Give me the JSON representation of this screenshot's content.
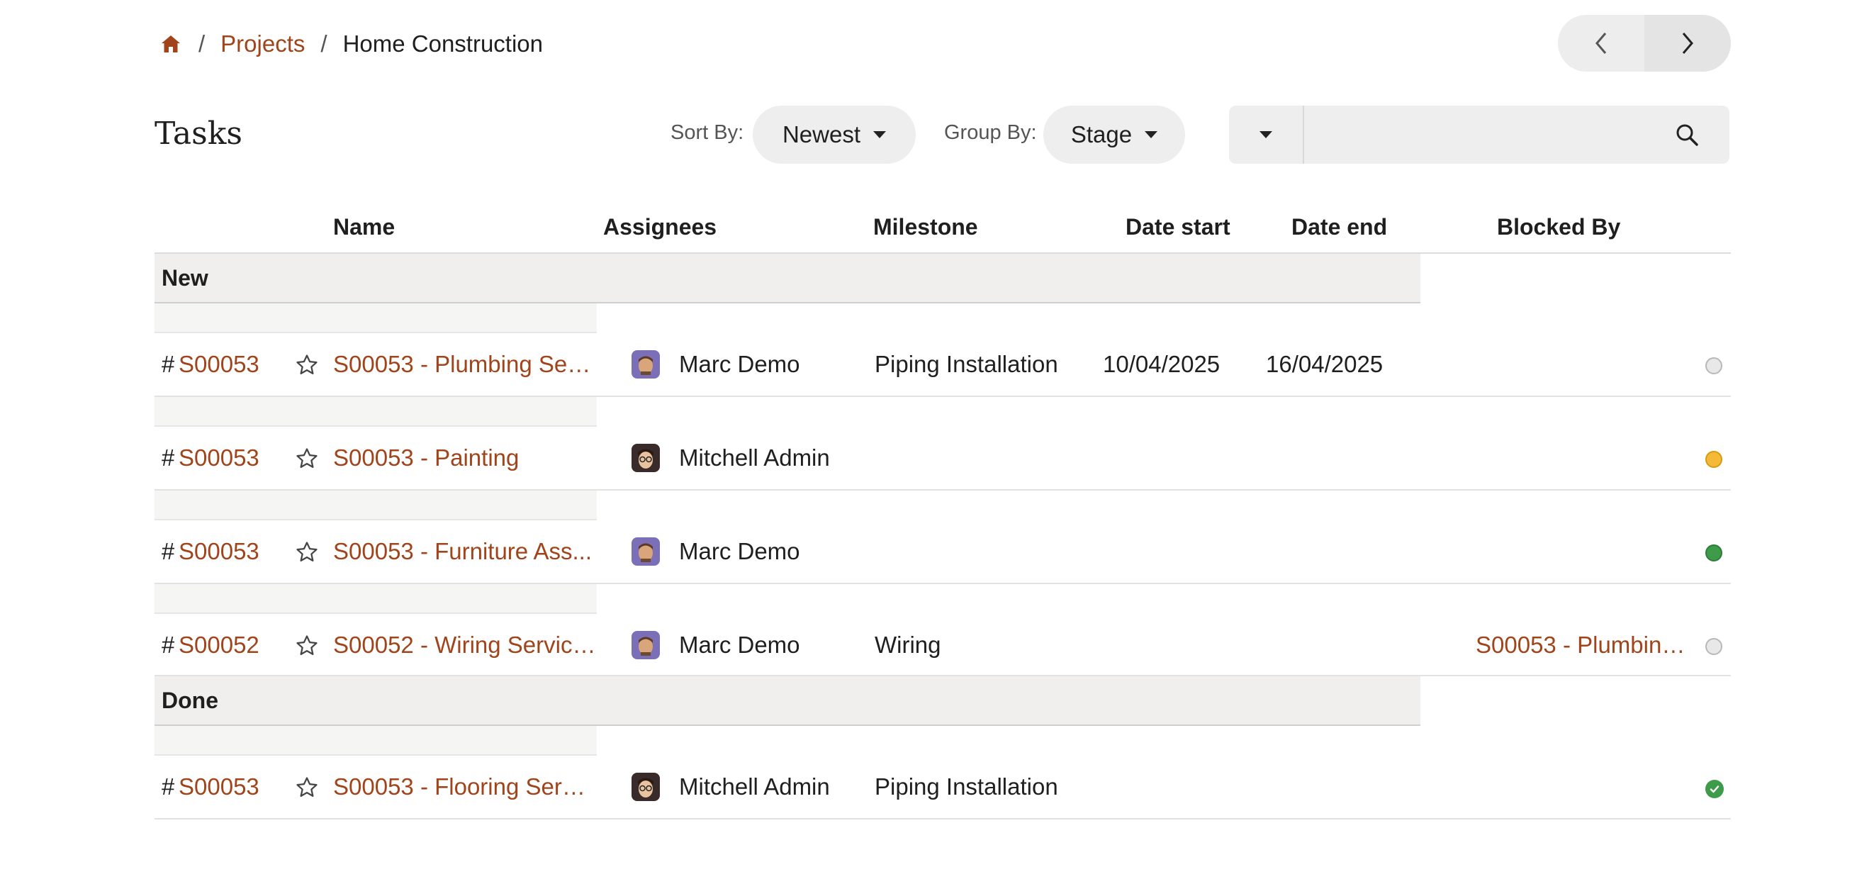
{
  "breadcrumb": {
    "projects": "Projects",
    "current": "Home Construction"
  },
  "page_title": "Tasks",
  "sort": {
    "label": "Sort By:",
    "value": "Newest"
  },
  "group": {
    "label": "Group By:",
    "value": "Stage"
  },
  "search": {
    "placeholder": ""
  },
  "columns": {
    "name": "Name",
    "assignees": "Assignees",
    "milestone": "Milestone",
    "date_start": "Date start",
    "date_end": "Date end",
    "blocked_by": "Blocked By"
  },
  "groups": [
    {
      "label": "New",
      "rows": [
        {
          "hash": "#",
          "ref": "S00053",
          "name": "S00053 - Plumbing Serv...",
          "assignee": "Marc Demo",
          "avatar": "marc",
          "milestone": "Piping Installation",
          "date_start": "10/04/2025",
          "date_end": "16/04/2025",
          "blocked_by": "",
          "status": "grey"
        },
        {
          "hash": "#",
          "ref": "S00053",
          "name": "S00053 - Painting",
          "assignee": "Mitchell Admin",
          "avatar": "mitchell",
          "milestone": "",
          "date_start": "",
          "date_end": "",
          "blocked_by": "",
          "status": "yellow"
        },
        {
          "hash": "#",
          "ref": "S00053",
          "name": "S00053 - Furniture Ass...",
          "assignee": "Marc Demo",
          "avatar": "marc",
          "milestone": "",
          "date_start": "",
          "date_end": "",
          "blocked_by": "",
          "status": "green"
        },
        {
          "hash": "#",
          "ref": "S00052",
          "name": "S00052 - Wiring Services",
          "assignee": "Marc Demo",
          "avatar": "marc",
          "milestone": "Wiring",
          "date_start": "",
          "date_end": "",
          "blocked_by": "S00053 - Plumbing ...",
          "status": "grey"
        }
      ]
    },
    {
      "label": "Done",
      "rows": [
        {
          "hash": "#",
          "ref": "S00053",
          "name": "S00053 - Flooring Servi...",
          "assignee": "Mitchell Admin",
          "avatar": "mitchell",
          "milestone": "Piping Installation",
          "date_start": "",
          "date_end": "",
          "blocked_by": "",
          "status": "done"
        }
      ]
    }
  ],
  "colors": {
    "accent": "#a0451b",
    "status_grey": "#e8e8e8",
    "status_yellow": "#f4b936",
    "status_green": "#3e9b4a"
  }
}
